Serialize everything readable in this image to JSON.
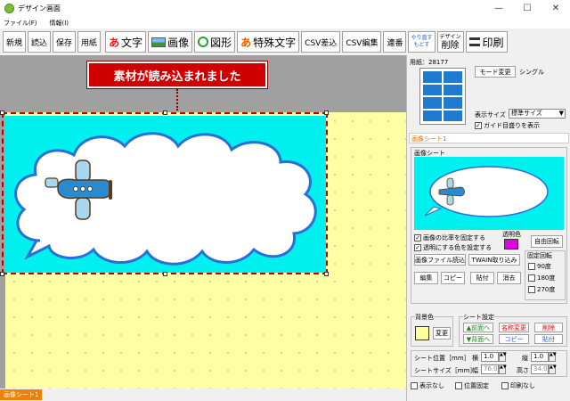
{
  "window": {
    "title": "デザイン画面",
    "minimize": "—",
    "maximize": "☐",
    "close": "✕"
  },
  "menu": [
    "ファイル(F)",
    "情報(I)"
  ],
  "toolbar": {
    "new": "新規",
    "load": "読込",
    "save": "保存",
    "paper": "用紙",
    "text_glyph": "あ",
    "text": "文字",
    "image": "画像",
    "shape": "図形",
    "special_glyph": "あ",
    "special_text": "特殊文字",
    "csv_insert": "CSV差込",
    "csv_edit": "CSV編集",
    "serial": "連番",
    "undo": "やり直す",
    "redo": "もどす",
    "design_delete_small": "デザイン",
    "design_delete": "削除",
    "print": "印刷"
  },
  "canvas": {
    "notice": "素材が読み込まれました"
  },
  "status": {
    "tab": "画像シート1"
  },
  "panel": {
    "paper_label": "用紙：28177",
    "mode_button": "モード変更",
    "mode_value": "シングル",
    "display_size_label": "表示サイズ",
    "display_size_value": "標準サイズ",
    "guide_checkbox": "ガイド目盛りを表示",
    "sheet_title": "画像シート1",
    "image_sheet_label": "画像シート",
    "keep_ratio": "画像の比率を固定する",
    "transparent": "透明にする色を設定する",
    "transparent_color_label": "透明色",
    "transparent_color": "#e000e0",
    "auto_rotate": "自由回転",
    "load_file": "画像ファイル読込",
    "twain": "TWAIN取り込み",
    "fixed_rotate_label": "固定回転",
    "rot90": "90度",
    "rot180": "180度",
    "rot270": "270度",
    "edit": "編集",
    "copy": "コピー",
    "paste": "貼付",
    "erase": "消去",
    "bg_color_label": "背景色",
    "bg_color": "#ffff99",
    "bg_change": "変更",
    "sheet_settings_label": "シート設定",
    "front": "▲前面へ",
    "back": "▼背面へ",
    "rename": "名称変更",
    "delete": "削除",
    "sheet_copy": "コピー",
    "sheet_paste": "貼付",
    "pos_label": "シート位置［mm］",
    "x_label": "横",
    "x_value": "1.0",
    "y_label": "縦",
    "y_value": "1.0",
    "size_label": "シートサイズ［mm］",
    "w_label": "幅",
    "w_value": "76.0",
    "h_label": "高さ",
    "h_value": "34.0",
    "hide": "表示なし",
    "fix_pos": "位置固定",
    "no_print": "印刷なし"
  },
  "colors": {
    "accent_cyan": "#00f0f0",
    "paper_yellow": "#ffffa6",
    "notice_red": "#d10000"
  }
}
